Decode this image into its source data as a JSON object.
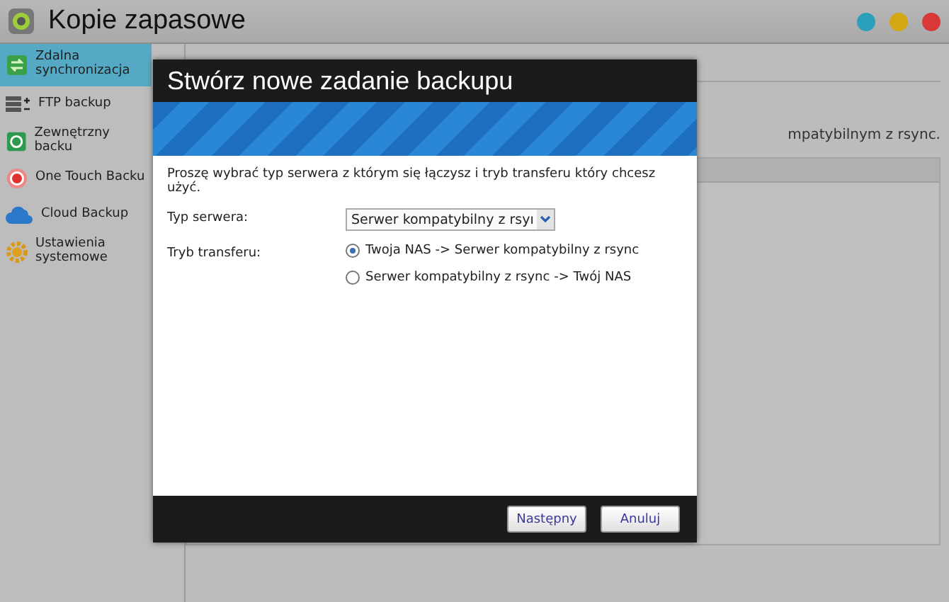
{
  "window": {
    "title": "Kopie zapasowe"
  },
  "sidebar": {
    "items": [
      {
        "label": "Zdalna synchronizacja",
        "selected": true
      },
      {
        "label": "FTP backup",
        "selected": false
      },
      {
        "label": "Zewnętrzny backu",
        "selected": false
      },
      {
        "label": "One Touch Backu",
        "selected": false
      },
      {
        "label": "Cloud Backup",
        "selected": false
      },
      {
        "label": "Ustawienia systemowe",
        "selected": false
      }
    ]
  },
  "content": {
    "text": "mpatybilnym z rsync."
  },
  "dialog": {
    "title": "Stwórz nowe zadanie backupu",
    "intro": "Proszę wybrać typ serwera z którym się łączysz i tryb transferu który chcesz użyć.",
    "server_type": {
      "label": "Typ serwera:",
      "value": "Serwer kompatybilny z rsyı"
    },
    "transfer_mode": {
      "label": "Tryb transferu:",
      "options": [
        {
          "label": "Twoja NAS -> Serwer kompatybilny z rsync",
          "selected": true
        },
        {
          "label": "Serwer kompatybilny z rsync -> Twój NAS",
          "selected": false
        }
      ]
    },
    "buttons": [
      "Następny",
      "Anuluj"
    ]
  }
}
